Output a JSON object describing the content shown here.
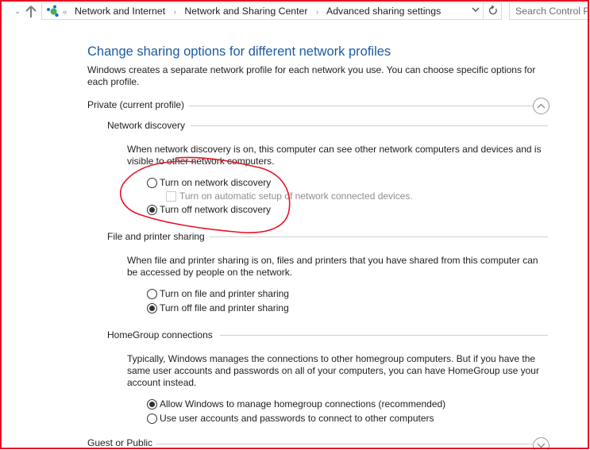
{
  "toolbar": {
    "recent_icon": "chevron-down-icon",
    "up_icon": "up-arrow-icon",
    "location_icon": "network-icon",
    "overflow": "«",
    "breadcrumbs": [
      "Network and Internet",
      "Network and Sharing Center",
      "Advanced sharing settings"
    ],
    "separator": "›",
    "dropdown_icon": "chevron-down-icon",
    "refresh_icon": "refresh-icon",
    "search_placeholder": "Search Control Panel"
  },
  "page": {
    "title": "Change sharing options for different network profiles",
    "intro": "Windows creates a separate network profile for each network you use. You can choose specific options for each profile."
  },
  "profiles": {
    "private": {
      "label": "Private (current profile)",
      "expanded": true,
      "toggle_icon": "chevron-up-icon",
      "network_discovery": {
        "title": "Network discovery",
        "description": "When network discovery is on, this computer can see other network computers and devices and is visible to other network computers.",
        "options": [
          {
            "label": "Turn on network discovery",
            "checked": false
          },
          {
            "label": "Turn off network discovery",
            "checked": true
          }
        ],
        "auto_setup": {
          "label": "Turn on automatic setup of network connected devices.",
          "checked": false,
          "enabled": false
        }
      },
      "file_printer_sharing": {
        "title": "File and printer sharing",
        "description": "When file and printer sharing is on, files and printers that you have shared from this computer can be accessed by people on the network.",
        "options": [
          {
            "label": "Turn on file and printer sharing",
            "checked": false
          },
          {
            "label": "Turn off file and printer sharing",
            "checked": true
          }
        ]
      },
      "homegroup": {
        "title": "HomeGroup connections",
        "description": "Typically, Windows manages the connections to other homegroup computers. But if you have the same user accounts and passwords on all of your computers, you can have HomeGroup use your account instead.",
        "options": [
          {
            "label": "Allow Windows to manage homegroup connections (recommended)",
            "checked": true
          },
          {
            "label": "Use user accounts and passwords to connect to other computers",
            "checked": false
          }
        ]
      }
    },
    "guest": {
      "label": "Guest or Public",
      "expanded": false,
      "toggle_icon": "chevron-down-icon"
    }
  },
  "annotation": {
    "type": "hand-drawn-circle",
    "color": "#e81123",
    "target": "Network discovery options"
  },
  "frame_color": "#e81123",
  "title_color": "#1e5aa0"
}
